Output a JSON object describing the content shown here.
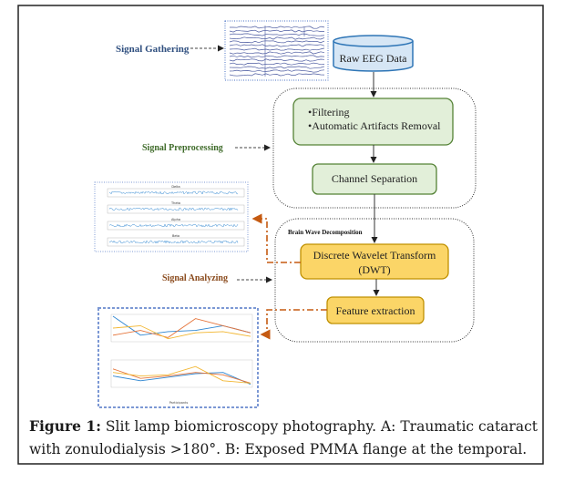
{
  "stages": {
    "gathering": {
      "label": "Signal Gathering",
      "color": "#2f4f7f"
    },
    "preprocessing": {
      "label": "Signal Preprocessing",
      "color": "#3f6b2a"
    },
    "analyzing": {
      "label": "Signal Analyzing",
      "color": "#8a4a1c"
    }
  },
  "nodes": {
    "raw_data": "Raw EEG Data",
    "filtering_items": [
      "•Filtering",
      "•Automatic Artifacts Removal"
    ],
    "channel_separation": "Channel Separation",
    "group_label": "Brain Wave Decomposition",
    "dwt_line1": "Discrete Wavelet Transform",
    "dwt_line2": "(DWT)",
    "feature_extraction": "Feature extraction"
  },
  "thumbnails": {
    "bands": [
      "Delta",
      "Theta",
      "Alpha",
      "Beta"
    ],
    "line_chart_xlabel": "Participants"
  },
  "colors": {
    "green_fill": "#e2efd9",
    "green_border": "#548235",
    "yellow_fill": "#fbd567",
    "yellow_border": "#bf9000",
    "cylinder_fill": "#d6e6f5",
    "cylinder_border": "#2e75b6",
    "orange_connector": "#c55a11"
  },
  "caption": {
    "label": "Figure 1:",
    "text": " Slit lamp biomicroscopy photography. A: Traumatic cataract with zonulodialysis >180°. B: Exposed PMMA flange at the temporal."
  }
}
